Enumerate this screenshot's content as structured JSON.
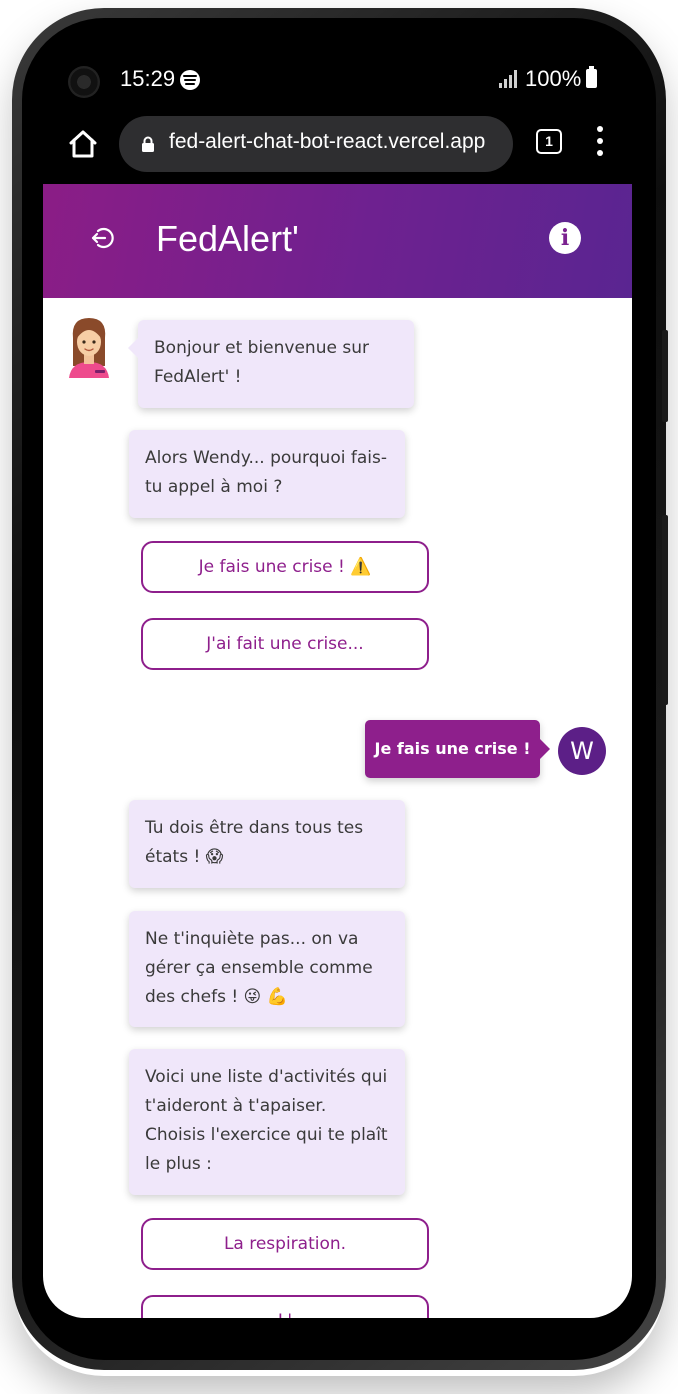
{
  "status_bar": {
    "time": "15:29",
    "battery": "100%"
  },
  "browser": {
    "url": "fed-alert-chat-bot-react.vercel.app",
    "tab_count": "1"
  },
  "app": {
    "title": "FedAlert'"
  },
  "chat": {
    "messages": [
      {
        "text": "Bonjour et bienvenue sur FedAlert' !"
      },
      {
        "text": "Alors Wendy... pourquoi fais-tu appel à moi ?"
      }
    ],
    "options_1": [
      {
        "label": "Je fais une crise ! ⚠️"
      },
      {
        "label": "J'ai fait une crise..."
      }
    ],
    "user_message": "Je fais une crise !",
    "user_initial": "W",
    "replies": [
      {
        "text": "Tu dois être dans tous tes états ! 😱"
      },
      {
        "text": "Ne t'inquiète pas... on va gérer ça ensemble comme des chefs ! 😜 💪"
      },
      {
        "text": "Voici une liste d'activités qui t'aideront à t'apaiser. Choisis l'exercice qui te plaît le plus :"
      }
    ],
    "options_2": [
      {
        "label": "La respiration."
      },
      {
        "label": "L'"
      }
    ]
  },
  "colors": {
    "header_gradient_start": "#8b1d86",
    "header_gradient_end": "#5a2591",
    "accent": "#8e1f8c",
    "bubble_bg": "#f0e7fa",
    "user_avatar": "#5c1f87"
  }
}
